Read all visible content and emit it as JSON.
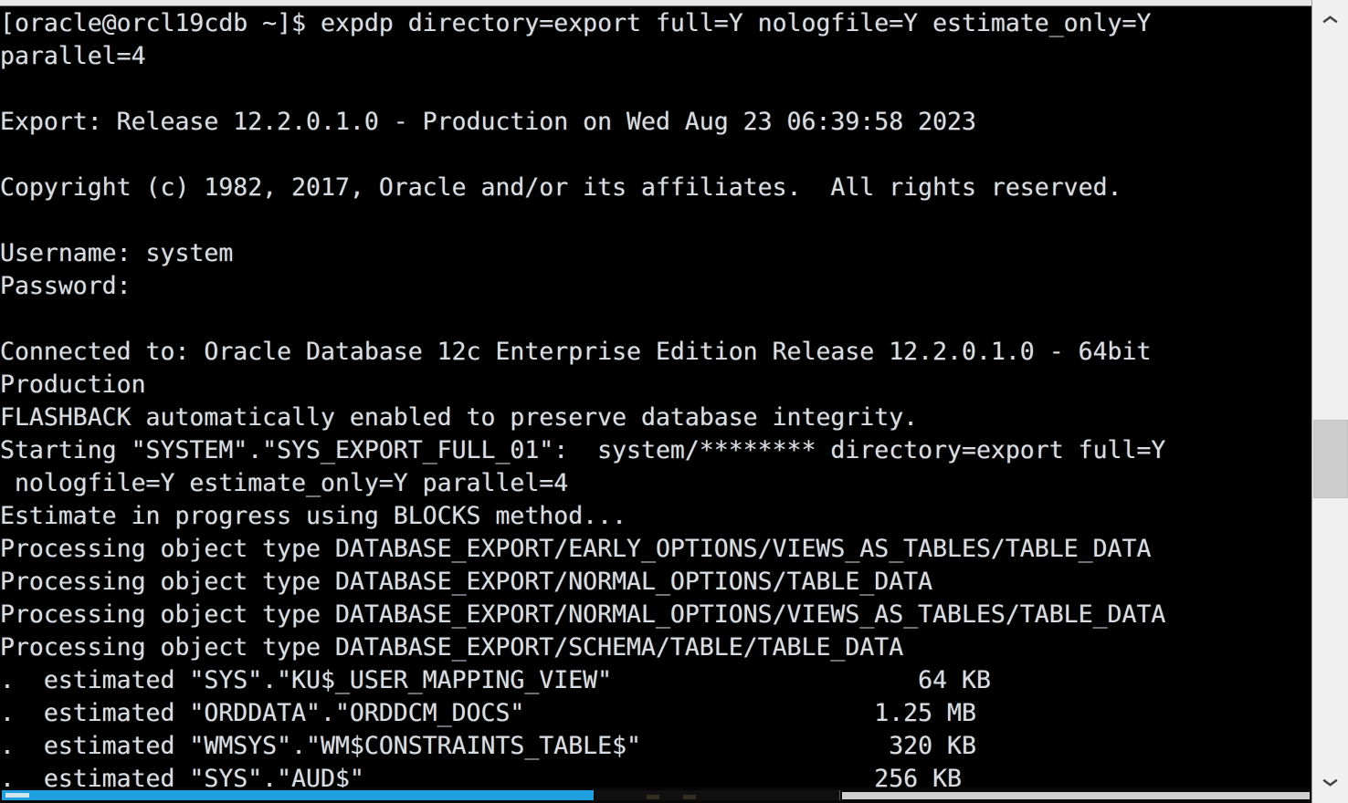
{
  "window": {
    "type": "terminal-emulator",
    "background_color": "#000000",
    "text_color": "#d8dde3"
  },
  "terminal": {
    "prompt": "[oracle@orcl19cdb ~]$",
    "command": "expdp directory=export full=Y nologfile=Y estimate_only=Y parallel=4",
    "lines": [
      "[oracle@orcl19cdb ~]$ expdp directory=export full=Y nologfile=Y estimate_only=Y",
      "parallel=4",
      "",
      "Export: Release 12.2.0.1.0 - Production on Wed Aug 23 06:39:58 2023",
      "",
      "Copyright (c) 1982, 2017, Oracle and/or its affiliates.  All rights reserved.",
      "",
      "Username: system",
      "Password:",
      "",
      "Connected to: Oracle Database 12c Enterprise Edition Release 12.2.0.1.0 - 64bit",
      "Production",
      "FLASHBACK automatically enabled to preserve database integrity.",
      "Starting \"SYSTEM\".\"SYS_EXPORT_FULL_01\":  system/******** directory=export full=Y",
      " nologfile=Y estimate_only=Y parallel=4",
      "Estimate in progress using BLOCKS method...",
      "Processing object type DATABASE_EXPORT/EARLY_OPTIONS/VIEWS_AS_TABLES/TABLE_DATA",
      "Processing object type DATABASE_EXPORT/NORMAL_OPTIONS/TABLE_DATA",
      "Processing object type DATABASE_EXPORT/NORMAL_OPTIONS/VIEWS_AS_TABLES/TABLE_DATA",
      "Processing object type DATABASE_EXPORT/SCHEMA/TABLE/TABLE_DATA",
      ".  estimated \"SYS\".\"KU$_USER_MAPPING_VIEW\"                     64 KB",
      ".  estimated \"ORDDATA\".\"ORDDCM_DOCS\"                        1.25 MB",
      ".  estimated \"WMSYS\".\"WM$CONSTRAINTS_TABLE$\"                 320 KB",
      ".  estimated \"SYS\".\"AUD$\"                                   256 KB"
    ],
    "session": {
      "username_prompt": "Username:",
      "username_value": "system",
      "password_prompt": "Password:",
      "password_value": "",
      "export_release": "12.2.0.1.0",
      "export_timestamp": "Wed Aug 23 06:39:58 2023",
      "copyright": "Copyright (c) 1982, 2017, Oracle and/or its affiliates.  All rights reserved.",
      "database_banner": "Oracle Database 12c Enterprise Edition Release 12.2.0.1.0 - 64bit Production",
      "job_name": "\"SYSTEM\".\"SYS_EXPORT_FULL_01\"",
      "estimate_method": "BLOCKS"
    },
    "estimated_objects": [
      {
        "owner": "SYS",
        "object": "KU$_USER_MAPPING_VIEW",
        "size": "64 KB"
      },
      {
        "owner": "ORDDATA",
        "object": "ORDDCM_DOCS",
        "size": "1.25 MB"
      },
      {
        "owner": "WMSYS",
        "object": "WM$CONSTRAINTS_TABLE$",
        "size": "320 KB"
      },
      {
        "owner": "SYS",
        "object": "AUD$",
        "size": "256 KB"
      }
    ],
    "object_types": [
      "DATABASE_EXPORT/EARLY_OPTIONS/VIEWS_AS_TABLES/TABLE_DATA",
      "DATABASE_EXPORT/NORMAL_OPTIONS/TABLE_DATA",
      "DATABASE_EXPORT/NORMAL_OPTIONS/VIEWS_AS_TABLES/TABLE_DATA",
      "DATABASE_EXPORT/SCHEMA/TABLE/TABLE_DATA"
    ]
  },
  "scrollbars": {
    "vertical": {
      "up_arrow_icon": "chevron-up-icon",
      "down_arrow_icon": "chevron-down-icon",
      "thumb_color": "#cdcdcd",
      "track_color": "#f0f0f0"
    },
    "horizontal": {
      "thumb_color": "#1fa0e0"
    }
  }
}
